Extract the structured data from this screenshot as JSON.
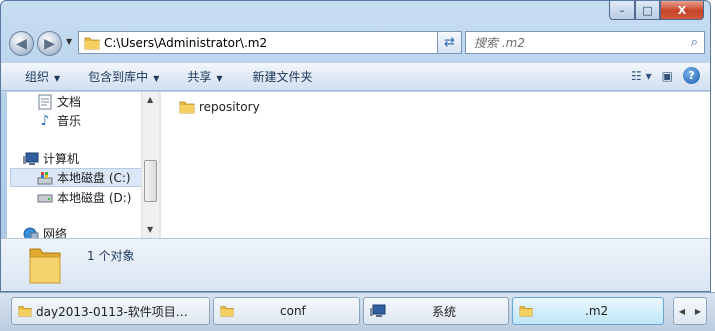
{
  "window": {
    "caption_buttons": {
      "minimize": "–",
      "maximize": "□",
      "close": "X"
    }
  },
  "address_bar": {
    "path": "C:\\Users\\Administrator\\.m2",
    "search_placeholder": "搜索 .m2"
  },
  "commands": {
    "organize": "组织",
    "include_in_library": "包含到库中",
    "share": "共享",
    "new_folder": "新建文件夹"
  },
  "nav_pane": {
    "items": [
      {
        "label": "文档",
        "icon": "documents-icon"
      },
      {
        "label": "音乐",
        "icon": "music-icon"
      },
      {
        "label": "计算机",
        "icon": "computer-icon"
      },
      {
        "label": "本地磁盘 (C:)",
        "icon": "system-drive-icon",
        "selected": true
      },
      {
        "label": "本地磁盘 (D:)",
        "icon": "drive-icon"
      },
      {
        "label": "网络",
        "icon": "network-icon"
      }
    ]
  },
  "content": {
    "items": [
      {
        "name": "repository",
        "type": "folder"
      }
    ]
  },
  "details": {
    "count": "1 个对象"
  },
  "taskbar": {
    "items": [
      {
        "label": "day2013-0113-软件项目…",
        "icon": "folder-icon"
      },
      {
        "label": "conf",
        "icon": "folder-icon"
      },
      {
        "label": "系统",
        "icon": "system-icon"
      },
      {
        "label": ".m2",
        "icon": "folder-icon",
        "active": true
      }
    ]
  },
  "colors": {
    "frame": "#b4cfe9",
    "folder": "#e8b93f",
    "selection": "#dbe7f6",
    "active_task": "#bfe6f8"
  }
}
